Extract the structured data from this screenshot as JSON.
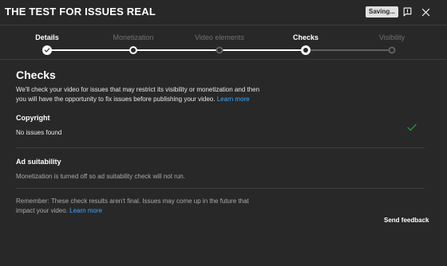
{
  "header": {
    "video_title": "THE TEST FOR ISSUES REAL",
    "saving_label": "Saving...",
    "feedback_icon": "flag-feedback-icon",
    "close_icon": "close-icon"
  },
  "stepper": {
    "steps": [
      {
        "label": "Details",
        "state": "done"
      },
      {
        "label": "Monetization",
        "state": "done"
      },
      {
        "label": "Video elements",
        "state": "done"
      },
      {
        "label": "Checks",
        "state": "current"
      },
      {
        "label": "Visibility",
        "state": "pending"
      }
    ]
  },
  "checks": {
    "title": "Checks",
    "intro": "We'll check your video for issues that may restrict its visibility or monetization and then you will have the opportunity to fix issues before publishing your video.",
    "intro_link": "Learn more",
    "copyright": {
      "title": "Copyright",
      "status": "No issues found",
      "status_icon": "checkmark-icon",
      "status_color": "#2ba640"
    },
    "ad_suitability": {
      "title": "Ad suitability",
      "status": "Monetization is turned off so ad suitability check will not run."
    },
    "remember": "Remember: These check results aren't final. Issues may come up in the future that impact your video.",
    "remember_link": "Learn more",
    "send_feedback": "Send feedback"
  },
  "colors": {
    "background": "#282828",
    "link": "#3ea6ff",
    "divider": "#3d3d3d"
  }
}
